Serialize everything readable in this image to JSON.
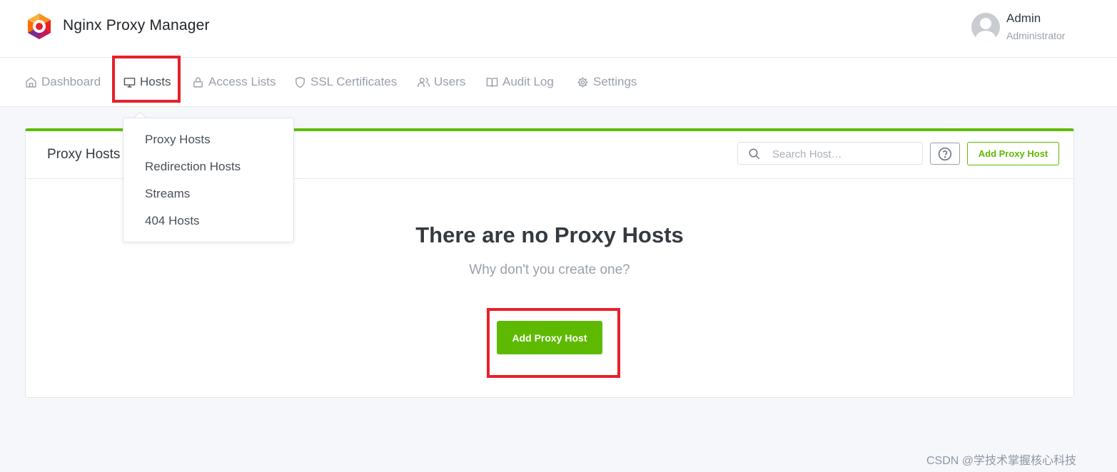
{
  "app": {
    "title": "Nginx Proxy Manager"
  },
  "user": {
    "name": "Admin",
    "role": "Administrator"
  },
  "nav": {
    "items": [
      {
        "label": "Dashboard",
        "icon": "home-icon"
      },
      {
        "label": "Hosts",
        "icon": "monitor-icon",
        "active": true
      },
      {
        "label": "Access Lists",
        "icon": "lock-icon"
      },
      {
        "label": "SSL Certificates",
        "icon": "shield-icon"
      },
      {
        "label": "Users",
        "icon": "users-icon"
      },
      {
        "label": "Audit Log",
        "icon": "book-icon"
      },
      {
        "label": "Settings",
        "icon": "gear-icon"
      }
    ]
  },
  "hosts_menu": {
    "items": [
      "Proxy Hosts",
      "Redirection Hosts",
      "Streams",
      "404 Hosts"
    ]
  },
  "card": {
    "title": "Proxy Hosts",
    "search_placeholder": "Search Host…",
    "add_button": "Add Proxy Host",
    "empty_title": "There are no Proxy Hosts",
    "empty_subtitle": "Why don't you create one?",
    "primary_button": "Add Proxy Host"
  },
  "watermark": "CSDN @学技术掌握核心科技",
  "colors": {
    "accent": "#5eba00",
    "highlight": "#e8202a",
    "muted": "#9aa0ac"
  }
}
